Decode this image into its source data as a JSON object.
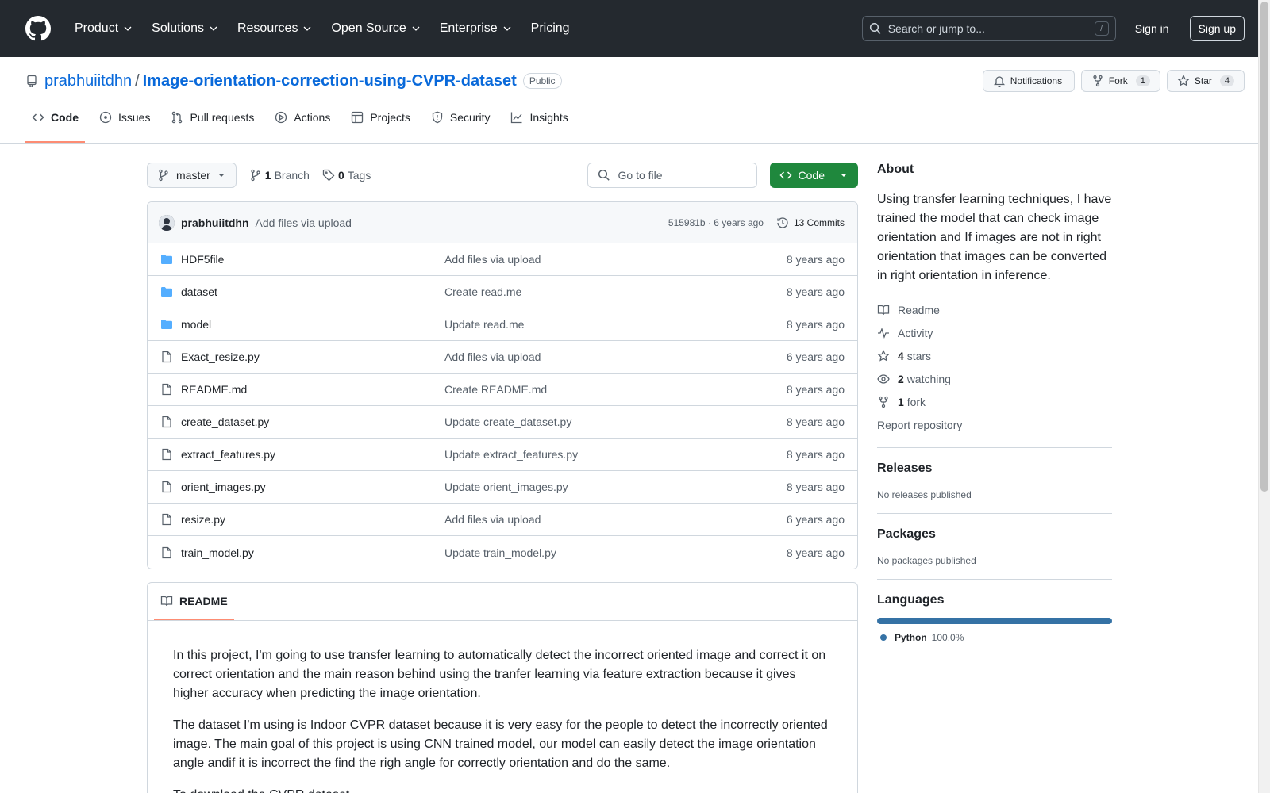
{
  "colors": {
    "header_bg": "#24292f",
    "accent": "#0969da",
    "primary_green": "#1f883d",
    "active_tab": "#fd8c73",
    "python": "#3572A5"
  },
  "header": {
    "nav": [
      "Product",
      "Solutions",
      "Resources",
      "Open Source",
      "Enterprise",
      "Pricing"
    ],
    "search_placeholder": "Search or jump to...",
    "search_shortcut": "/",
    "signin": "Sign in",
    "signup": "Sign up"
  },
  "repo": {
    "owner": "prabhuiitdhn",
    "separator": "/",
    "name": "Image-orientation-correction-using-CVPR-dataset",
    "visibility": "Public",
    "notifications_label": "Notifications",
    "fork_label": "Fork",
    "fork_count": "1",
    "star_label": "Star",
    "star_count": "4"
  },
  "tabs": [
    "Code",
    "Issues",
    "Pull requests",
    "Actions",
    "Projects",
    "Security",
    "Insights"
  ],
  "toolbar": {
    "branch": "master",
    "branch_count": "1",
    "branch_label": "Branch",
    "tag_count": "0",
    "tag_label": "Tags",
    "goto_placeholder": "Go to file",
    "code_label": "Code"
  },
  "commit": {
    "author": "prabhuiitdhn",
    "message": "Add files via upload",
    "meta": "515981b · 6 years ago",
    "commits_label": "13 Commits"
  },
  "files": [
    {
      "name": "HDF5file",
      "type": "folder",
      "message": "Add files via upload",
      "time": "8 years ago"
    },
    {
      "name": "dataset",
      "type": "folder",
      "message": "Create read.me",
      "time": "8 years ago"
    },
    {
      "name": "model",
      "type": "folder",
      "message": "Update read.me",
      "time": "8 years ago"
    },
    {
      "name": "Exact_resize.py",
      "type": "file",
      "message": "Add files via upload",
      "time": "6 years ago"
    },
    {
      "name": "README.md",
      "type": "file",
      "message": "Create README.md",
      "time": "8 years ago"
    },
    {
      "name": "create_dataset.py",
      "type": "file",
      "message": "Update create_dataset.py",
      "time": "8 years ago"
    },
    {
      "name": "extract_features.py",
      "type": "file",
      "message": "Update extract_features.py",
      "time": "8 years ago"
    },
    {
      "name": "orient_images.py",
      "type": "file",
      "message": "Update orient_images.py",
      "time": "8 years ago"
    },
    {
      "name": "resize.py",
      "type": "file",
      "message": "Add files via upload",
      "time": "6 years ago"
    },
    {
      "name": "train_model.py",
      "type": "file",
      "message": "Update train_model.py",
      "time": "8 years ago"
    }
  ],
  "readme": {
    "tab_label": "README",
    "paragraphs": [
      "In this project, I'm going to use transfer learning to automatically detect the incorrect oriented image and correct it on correct orientation and the main reason behind using the tranfer learning via feature extraction because it gives higher accuracy when predicting the image orientation.",
      "The dataset I'm using is Indoor CVPR dataset because it is very easy for the people to detect the incorrectly oriented image. The main goal of this project is using CNN trained model, our model can easily detect the image orientation angle andif it is incorrect the find the righ angle for correctly orientation and do the same.",
      "To download the CVPR dataset"
    ]
  },
  "about": {
    "title": "About",
    "description": "Using transfer learning techniques, I have trained the model that can check image orientation and If images are not in right orientation that images can be converted in right orientation in inference.",
    "readme": "Readme",
    "activity": "Activity",
    "stars_count": "4",
    "stars_label": "stars",
    "watching_count": "2",
    "watching_label": "watching",
    "fork_count": "1",
    "fork_label": "fork",
    "report": "Report repository"
  },
  "releases": {
    "title": "Releases",
    "empty": "No releases published"
  },
  "packages": {
    "title": "Packages",
    "empty": "No packages published"
  },
  "languages": {
    "title": "Languages",
    "items": [
      {
        "name": "Python",
        "percent": "100.0%"
      }
    ]
  }
}
